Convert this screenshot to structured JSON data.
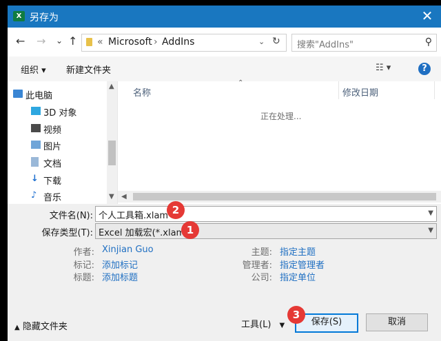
{
  "titlebar": {
    "app_icon_text": "X",
    "title": "另存为",
    "close_glyph": "✕"
  },
  "nav": {
    "back_glyph": "←",
    "forward_glyph": "→",
    "recent_glyph": "⌄",
    "up_glyph": "↑",
    "breadcrumb": {
      "sep_lead": "«",
      "items": [
        "Microsoft",
        "AddIns"
      ],
      "sep": "›"
    },
    "refresh_glyph": "↻",
    "search_placeholder": "搜索\"AddIns\""
  },
  "toolbar": {
    "organize": "组织 ▾",
    "new_folder": "新建文件夹",
    "view_glyph": "☷ ▾",
    "help": "?"
  },
  "navpane": {
    "items": [
      {
        "label": "此电脑",
        "icon": "pc-icon"
      },
      {
        "label": "3D 对象",
        "icon": "3d-objects-icon"
      },
      {
        "label": "视频",
        "icon": "video-icon"
      },
      {
        "label": "图片",
        "icon": "pictures-icon"
      },
      {
        "label": "文档",
        "icon": "documents-icon"
      },
      {
        "label": "下载",
        "icon": "downloads-icon"
      },
      {
        "label": "音乐",
        "icon": "music-icon"
      }
    ]
  },
  "filepane": {
    "columns": [
      "名称",
      "修改日期"
    ],
    "status": "正在处理..."
  },
  "form": {
    "filename_label": "文件名(N):",
    "filename_value": "个人工具箱.xlam",
    "filetype_label": "保存类型(T):",
    "filetype_value": "Excel 加载宏(*.xlam)",
    "badges": [
      "1",
      "2",
      "3"
    ]
  },
  "meta": {
    "author_label": "作者:",
    "author_value": "Xinjian Guo",
    "tags_label": "标记:",
    "tags_value": "添加标记",
    "title_label": "标题:",
    "title_value": "添加标题",
    "subject_label": "主题:",
    "subject_value": "指定主题",
    "manager_label": "管理者:",
    "manager_value": "指定管理者",
    "company_label": "公司:",
    "company_value": "指定单位"
  },
  "footer": {
    "hide_folders": "隐藏文件夹",
    "tools": "工具(L)",
    "save": "保存(S)",
    "cancel": "取消"
  },
  "colors": {
    "titlebar": "#1977c0",
    "link": "#1f6fc2",
    "badge": "#e53935",
    "excel": "#107c41"
  }
}
